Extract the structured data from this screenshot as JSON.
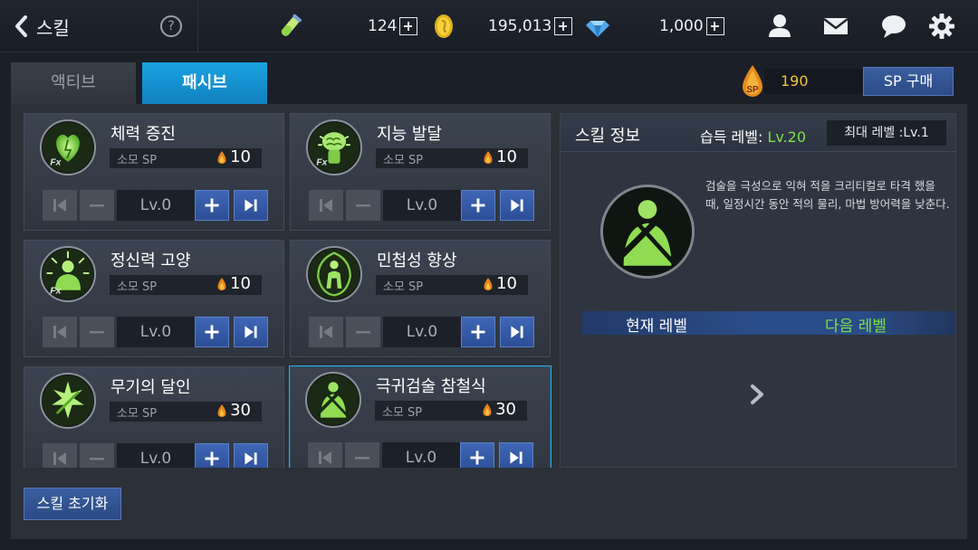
{
  "header": {
    "title": "스킬",
    "help": "?",
    "stamina": "124",
    "gold": "195,013",
    "gems": "1,000"
  },
  "tabs": [
    {
      "label": "액티브",
      "active": false
    },
    {
      "label": "패시브",
      "active": true
    }
  ],
  "sp": {
    "icon_text": "SP",
    "value": "190",
    "buy_label": "SP 구매"
  },
  "cost_label": "소모 SP",
  "skills": [
    {
      "name": "체력 증진",
      "cost": "10",
      "level": "Lv.0",
      "icon": "heart-fx-icon"
    },
    {
      "name": "지능 발달",
      "cost": "10",
      "level": "Lv.0",
      "icon": "brain-fx-icon"
    },
    {
      "name": "정신력 고양",
      "cost": "10",
      "level": "Lv.0",
      "icon": "spirit-fx-icon"
    },
    {
      "name": "민첩성 향상",
      "cost": "10",
      "level": "Lv.0",
      "icon": "agility-icon"
    },
    {
      "name": "무기의 달인",
      "cost": "30",
      "level": "Lv.0",
      "icon": "weapon-master-icon"
    },
    {
      "name": "극귀검술 참철식",
      "cost": "30",
      "level": "Lv.0",
      "icon": "slash-icon",
      "selected": true
    }
  ],
  "info": {
    "title": "스킬 정보",
    "acquire_label": "습득 레벨:",
    "acquire_value": "Lv.20",
    "max_level": "최대 레벨 :Lv.1",
    "description": "검술을 극성으로 익혀 적을 크리티컬로 타격 했을 때, 일정시간 동안 적의 물리, 마법 방어력을 낮춘다.",
    "current_level_label": "현재 레벨",
    "next_level_label": "다음 레벨"
  },
  "reset_label": "스킬 초기화",
  "colors": {
    "accent_green": "#7be24a",
    "tab_active": "#1aa3e0",
    "button_blue": "#3a5ea0",
    "sp_gold": "#f3c43a"
  }
}
